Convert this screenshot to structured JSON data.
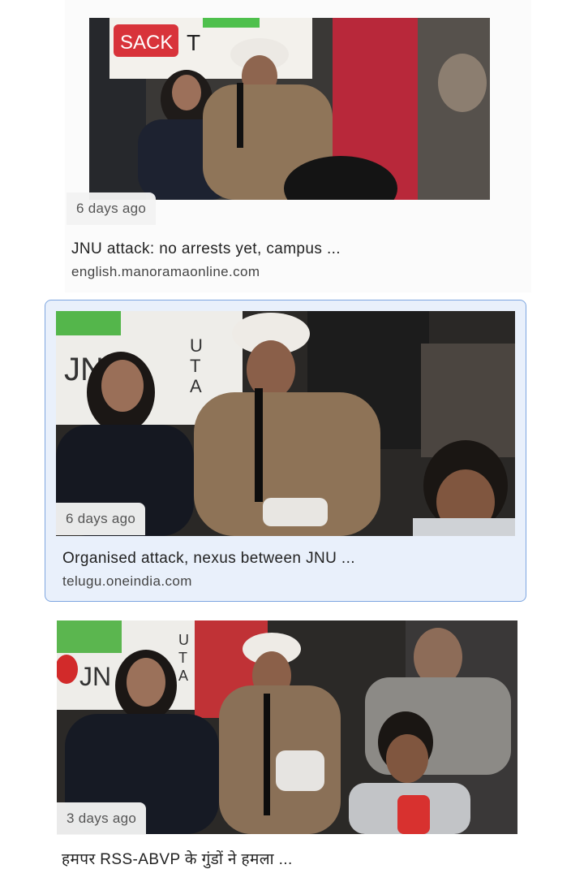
{
  "results": [
    {
      "time": "6 days ago",
      "title": "JNU attack: no arrests yet, campus ...",
      "source": "english.manoramaonline.com",
      "image": "protest-photo"
    },
    {
      "time": "6 days ago",
      "title": "Organised attack, nexus between JNU ...",
      "source": "telugu.oneindia.com",
      "image": "protest-photo",
      "selected": true
    },
    {
      "time": "3 days ago",
      "title": "हमपर RSS-ABVP के गुंडों ने हमला ...",
      "image": "protest-photo"
    }
  ],
  "colors": {
    "selected_background": "#e9f0fb",
    "selected_border": "#7ea6e0",
    "badge_background": "#f2f2f2"
  }
}
